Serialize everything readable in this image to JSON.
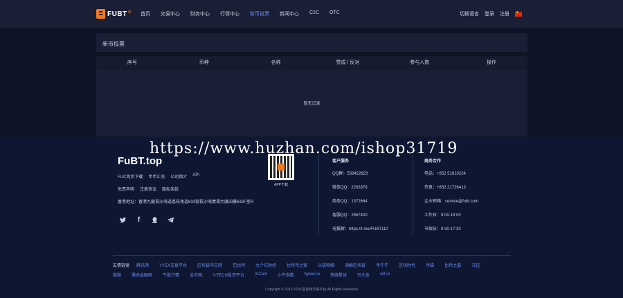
{
  "nav": {
    "logo_text": "FUBT",
    "logo_sub": "币",
    "items": [
      "首页",
      "交易中心",
      "财务中心",
      "行情中心",
      "新币投票",
      "新闻中心",
      "C2C",
      "OTC"
    ],
    "active_index": 4,
    "right": {
      "switch_label": "切换语言",
      "login_label": "登录",
      "register_label": "注册"
    }
  },
  "panel": {
    "title": "新币投票"
  },
  "table": {
    "headers": [
      "序号",
      "币种",
      "名称",
      "赞成 / 反对",
      "参与人数",
      "操作"
    ],
    "empty_text": "暂无记录"
  },
  "footer": {
    "brand": "FuBT.top",
    "links_row1": [
      "FUC简页下载",
      "币币汇兑",
      "公司简介",
      "API"
    ],
    "links_row2": [
      "免责声明",
      "注册协议",
      "隐私条款"
    ],
    "address": "香港地址：香港九龍長沙灣道荔枝角道833號長沙灣廣場大廈四樓633F室R",
    "qr_label": "APP下载",
    "contact": {
      "heading": "客户服务",
      "rows": [
        "QQ群：556422823",
        "微信QQ：2263378",
        "商务QQ：1372664",
        "客服QQ：2667400",
        "电报群：https://t.me/FUBT110"
      ]
    },
    "business": {
      "heading": "商务合作",
      "rows": [
        "电话：+852 51810224",
        "传真：+852 21726413",
        "企业邮箱：service@fubt.com",
        "工作日：9:00-18:00",
        "节假日：9:30-17:30"
      ]
    },
    "friends_label": "友情链接",
    "friends_row1": [
      "腾讯网",
      "YYEX交易平台",
      "区块链中文网",
      "巴比特",
      "九个亿财经",
      "比特币之家",
      "以链网络",
      "海鲸区块链",
      "币牛牛",
      "区块时代",
      "币猫",
      "比特之窗",
      "75区"
    ],
    "friends_row2": [
      "链链",
      "雅虎金融网",
      "牛股行情",
      "金币网",
      "Y-TECH投资平台",
      "AICoin",
      "小牛指数",
      "bysec.io",
      "快链星球",
      "币头条",
      "ulit.io"
    ],
    "copyright": "Copyright © 2013-2018 富比特交易平台 All Rights Reserved"
  },
  "watermark": "https://www.huzhan.com/ishop31719"
}
